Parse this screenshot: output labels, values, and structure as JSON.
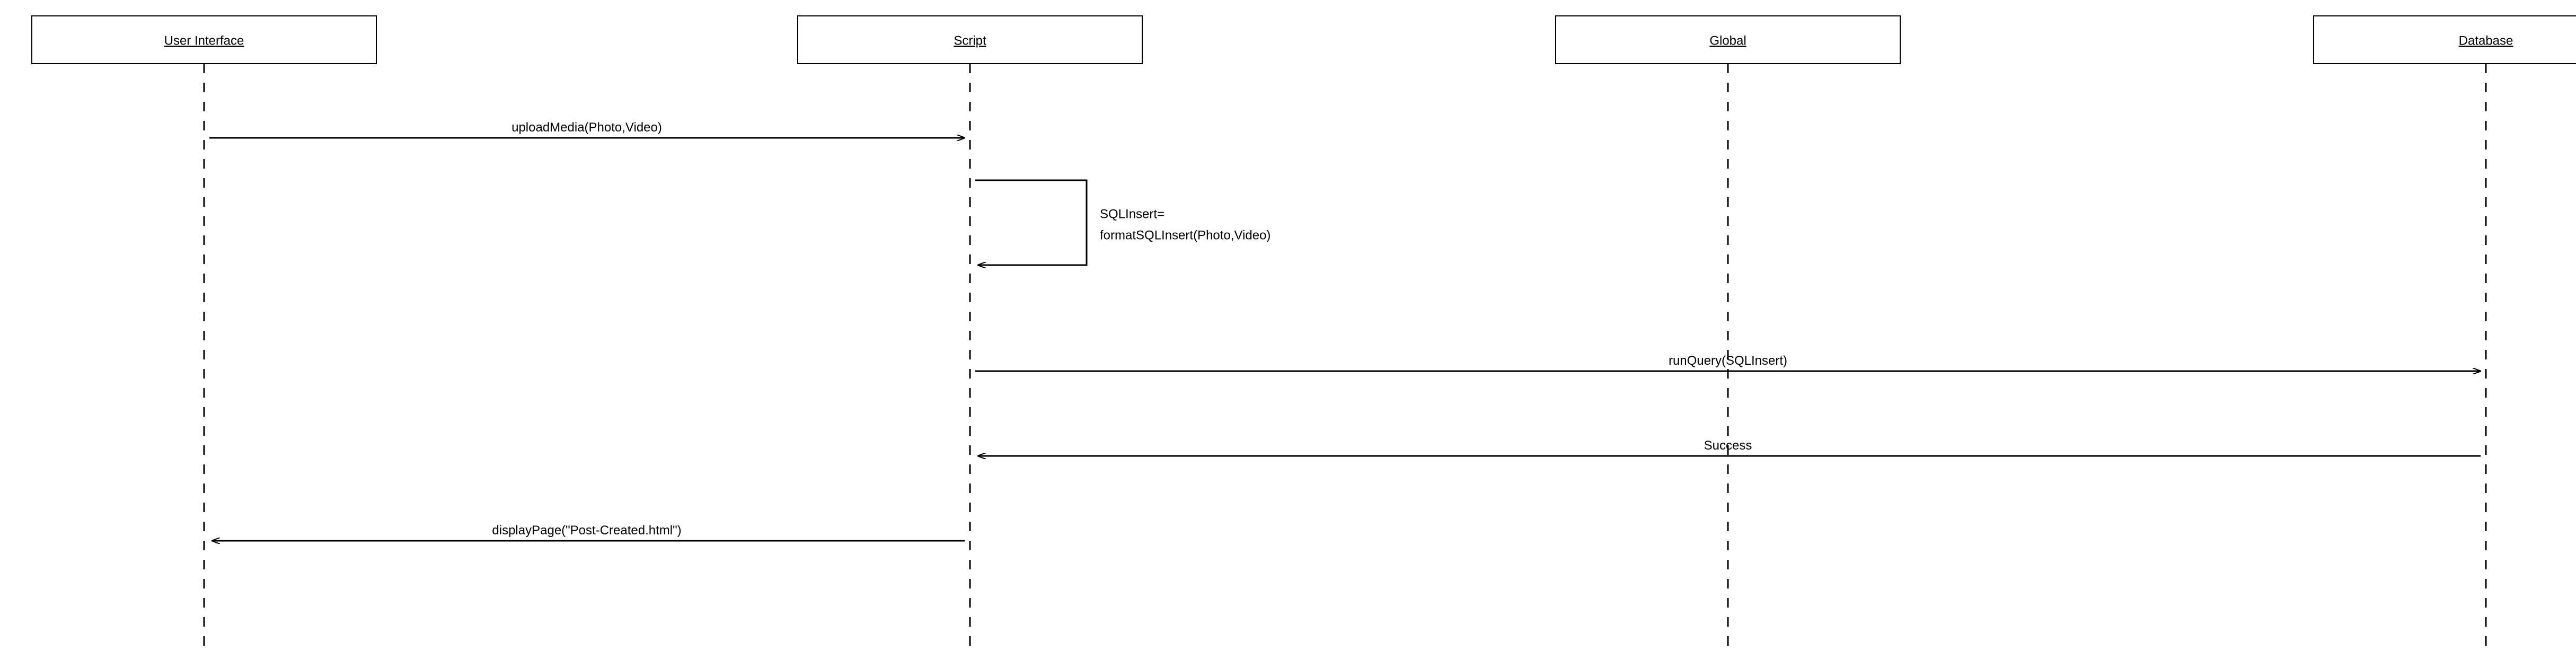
{
  "diagram": {
    "type": "sequence",
    "participants": [
      {
        "id": "ui",
        "label": "User Interface"
      },
      {
        "id": "script",
        "label": "Script"
      },
      {
        "id": "global",
        "label": "Global"
      },
      {
        "id": "database",
        "label": "Database"
      }
    ],
    "messages": [
      {
        "from": "ui",
        "to": "script",
        "label": "uploadMedia(Photo,Video)"
      },
      {
        "from": "script",
        "to": "script",
        "label_line1": "SQLInsert=",
        "label_line2": "formatSQLInsert(Photo,Video)"
      },
      {
        "from": "script",
        "to": "database",
        "label": "runQuery(SQLInsert)"
      },
      {
        "from": "database",
        "to": "script",
        "label": "Success"
      },
      {
        "from": "script",
        "to": "ui",
        "label": "displayPage(\"Post-Created.html\")"
      }
    ]
  }
}
